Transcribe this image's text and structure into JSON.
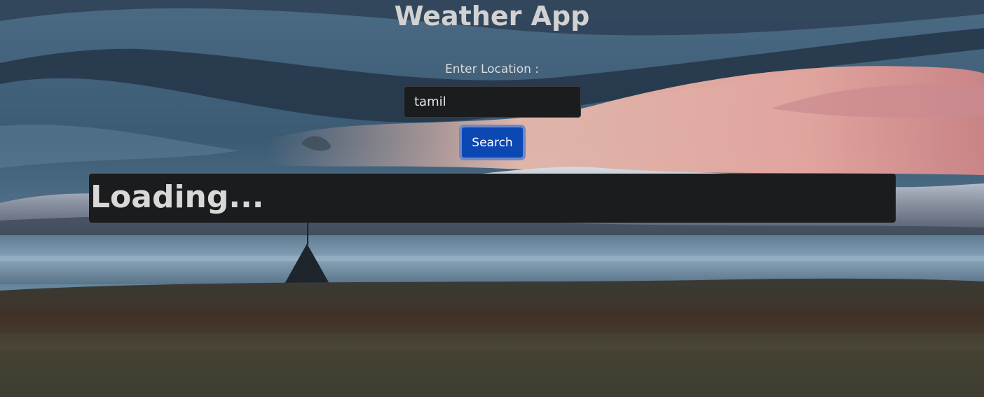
{
  "header": {
    "title": "Weather App"
  },
  "form": {
    "location_label": "Enter Location :",
    "location_value": "tamil",
    "search_label": "Search"
  },
  "result": {
    "status_text": "Loading..."
  },
  "colors": {
    "button_bg": "#0c48b4",
    "panel_bg": "#1b1c1e",
    "title_text": "#d2d2d2"
  }
}
